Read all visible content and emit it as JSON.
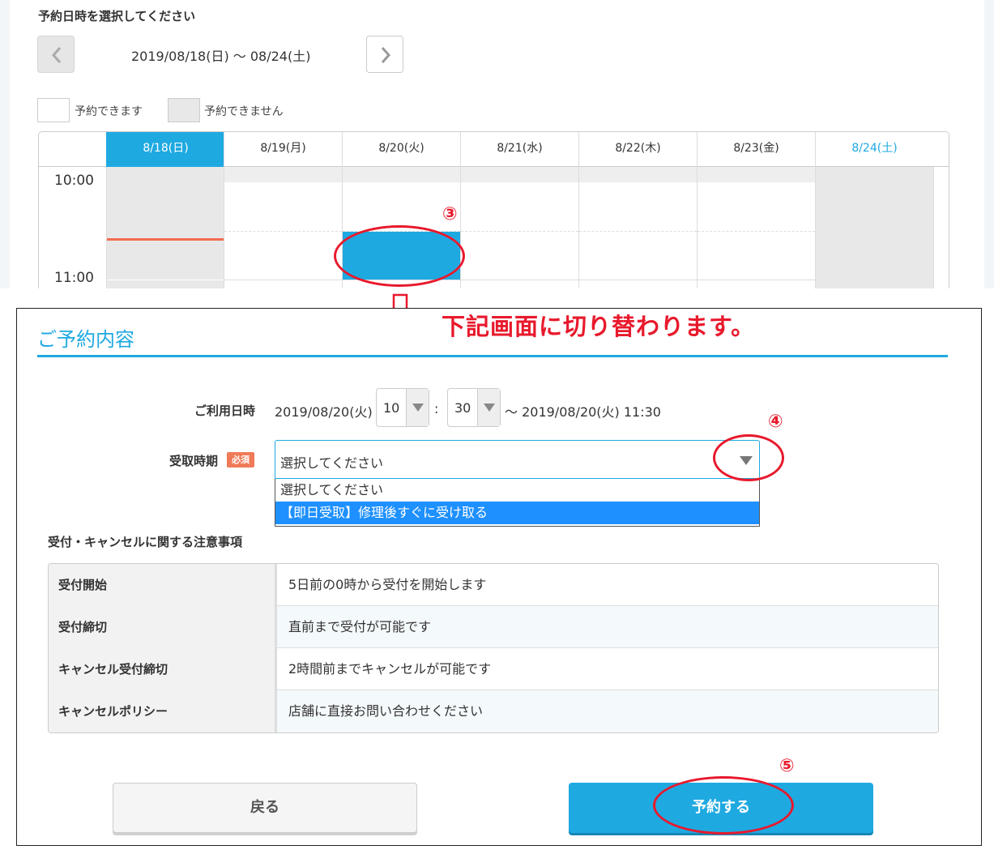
{
  "calendar": {
    "title": "予約日時を選択してください",
    "range": "2019/08/18(日) ～ 08/24(土)",
    "legend": {
      "available": "予約できます",
      "unavailable": "予約できません"
    },
    "days": [
      "8/18(日)",
      "8/19(月)",
      "8/20(火)",
      "8/21(水)",
      "8/22(木)",
      "8/23(金)",
      "8/24(土)"
    ],
    "times": [
      "10:00",
      "11:00"
    ],
    "active_day": "8/18(日)",
    "selected_slot": "8/20(火) 10:30"
  },
  "banner": "下記画面に切り替わります。",
  "reservation": {
    "title": "ご予約内容",
    "usage_label": "ご利用日時",
    "start_date": "2019/08/20(火)",
    "hour": "10",
    "minute": "30",
    "colon": ":",
    "end_text": "～ 2019/08/20(火) 11:30",
    "pickup_label": "受取時期",
    "required": "必須",
    "pickup_value": "選択してください",
    "pickup_options": [
      "選択してください",
      "【即日受取】修理後すぐに受け取る"
    ],
    "notes_title": "受付・キャンセルに関する注意事項",
    "notes": [
      {
        "label": "受付開始",
        "value": "5日前の0時から受付を開始します"
      },
      {
        "label": "受付締切",
        "value": "直前まで受付が可能です"
      },
      {
        "label": "キャンセル受付締切",
        "value": "2時間前までキャンセルが可能です"
      },
      {
        "label": "キャンセルポリシー",
        "value": "店舗に直接お問い合わせください"
      }
    ],
    "back_label": "戻る",
    "reserve_label": "予約する"
  },
  "annotations": {
    "step3": "③",
    "step4": "④",
    "step5": "⑤"
  },
  "colors": {
    "accent": "#1fa9e1",
    "annotation": "#e8192c",
    "now_line": "#f26b4f",
    "highlight": "#1e90ff"
  }
}
